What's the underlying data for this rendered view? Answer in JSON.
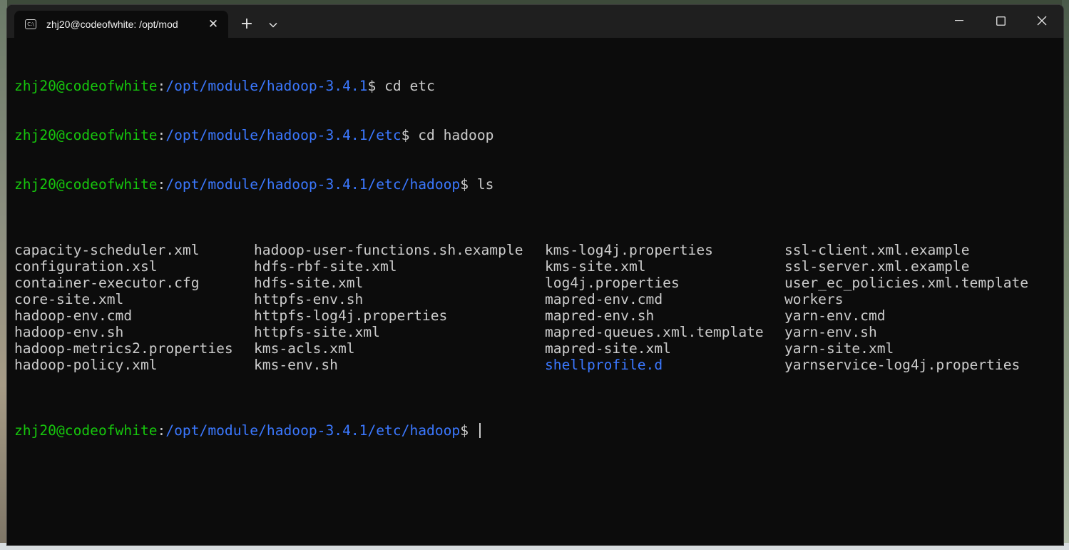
{
  "window": {
    "tab_title": "zhj20@codeofwhite: /opt/mod",
    "new_tab_label": "+",
    "close_tab_label": "✕",
    "minimize_label": "—",
    "maximize_label": "☐",
    "close_label": "✕"
  },
  "terminal": {
    "user_host": "zhj20@codeofwhite",
    "lines": [
      {
        "path": "/opt/module/hadoop-3.4.1",
        "command": "cd etc"
      },
      {
        "path": "/opt/module/hadoop-3.4.1/etc",
        "command": "cd hadoop"
      },
      {
        "path": "/opt/module/hadoop-3.4.1/etc/hadoop",
        "command": "ls"
      }
    ],
    "ls_columns": [
      [
        "capacity-scheduler.xml",
        "configuration.xsl",
        "container-executor.cfg",
        "core-site.xml",
        "hadoop-env.cmd",
        "hadoop-env.sh",
        "hadoop-metrics2.properties",
        "hadoop-policy.xml"
      ],
      [
        "hadoop-user-functions.sh.example",
        "hdfs-rbf-site.xml",
        "hdfs-site.xml",
        "httpfs-env.sh",
        "httpfs-log4j.properties",
        "httpfs-site.xml",
        "kms-acls.xml",
        "kms-env.sh"
      ],
      [
        "kms-log4j.properties",
        "kms-site.xml",
        "log4j.properties",
        "mapred-env.cmd",
        "mapred-env.sh",
        "mapred-queues.xml.template",
        "mapred-site.xml",
        "shellprofile.d"
      ],
      [
        "ssl-client.xml.example",
        "ssl-server.xml.example",
        "user_ec_policies.xml.template",
        "workers",
        "yarn-env.cmd",
        "yarn-env.sh",
        "yarn-site.xml",
        "yarnservice-log4j.properties"
      ]
    ],
    "directory_entries": [
      "shellprofile.d"
    ],
    "final_prompt_path": "/opt/module/hadoop-3.4.1/etc/hadoop",
    "colors": {
      "user": "#16c60c",
      "path": "#3b78ff",
      "text": "#cccccc",
      "background": "#0c0c0c"
    }
  }
}
